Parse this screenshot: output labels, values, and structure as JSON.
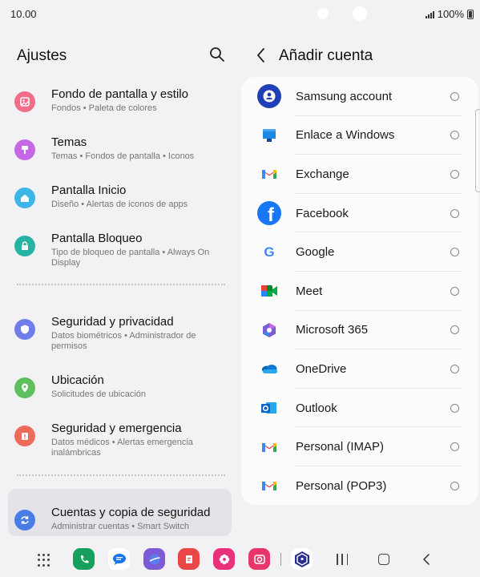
{
  "status": {
    "time": "10.00",
    "battery": "100%"
  },
  "left": {
    "title": "Ajustes",
    "items": [
      {
        "title": "Fondo de pantalla y estilo",
        "sub": "Fondos  •  Paleta de colores",
        "color": "#f26d8a",
        "icon": "wallpaper-icon"
      },
      {
        "title": "Temas",
        "sub": "Temas  •  Fondos de pantalla  •  Iconos",
        "color": "#c468e6",
        "icon": "themes-icon"
      },
      {
        "title": "Pantalla Inicio",
        "sub": "Diseño  •  Alertas de iconos de apps",
        "color": "#3cb6e6",
        "icon": "home-icon"
      },
      {
        "title": "Pantalla Bloqueo",
        "sub": "Tipo de bloqueo de pantalla  •  Always On Display",
        "color": "#27b3a3",
        "icon": "lock-icon"
      },
      {
        "title": "Seguridad y privacidad",
        "sub": "Datos biométricos  •  Administrador de permisos",
        "color": "#6f7de8",
        "icon": "shield-icon"
      },
      {
        "title": "Ubicación",
        "sub": "Solicitudes de ubicación",
        "color": "#5dbf5d",
        "icon": "location-icon"
      },
      {
        "title": "Seguridad y emergencia",
        "sub": "Datos médicos  •  Alertas emergencia inalámbricas",
        "color": "#ee6a5a",
        "icon": "emergency-icon"
      },
      {
        "title": "Cuentas y copia de seguridad",
        "sub": "Administrar cuentas  •  Smart Switch",
        "color": "#4a7ce8",
        "icon": "sync-icon"
      }
    ]
  },
  "right": {
    "title": "Añadir cuenta",
    "accounts": [
      {
        "label": "Samsung account",
        "icon": "samsung-account-icon"
      },
      {
        "label": "Enlace a Windows",
        "icon": "windows-link-icon"
      },
      {
        "label": "Exchange",
        "icon": "gmail-icon"
      },
      {
        "label": "Facebook",
        "icon": "facebook-icon"
      },
      {
        "label": "Google",
        "icon": "google-icon"
      },
      {
        "label": "Meet",
        "icon": "meet-icon"
      },
      {
        "label": "Microsoft 365",
        "icon": "microsoft365-icon"
      },
      {
        "label": "OneDrive",
        "icon": "onedrive-icon"
      },
      {
        "label": "Outlook",
        "icon": "outlook-icon"
      },
      {
        "label": "Personal (IMAP)",
        "icon": "gmail-icon"
      },
      {
        "label": "Personal (POP3)",
        "icon": "gmail-icon"
      }
    ]
  },
  "dock": {
    "apps": [
      "phone-icon",
      "messages-icon",
      "internet-icon",
      "notes-icon",
      "gallery-icon",
      "camera-icon",
      "secure-folder-icon"
    ]
  }
}
